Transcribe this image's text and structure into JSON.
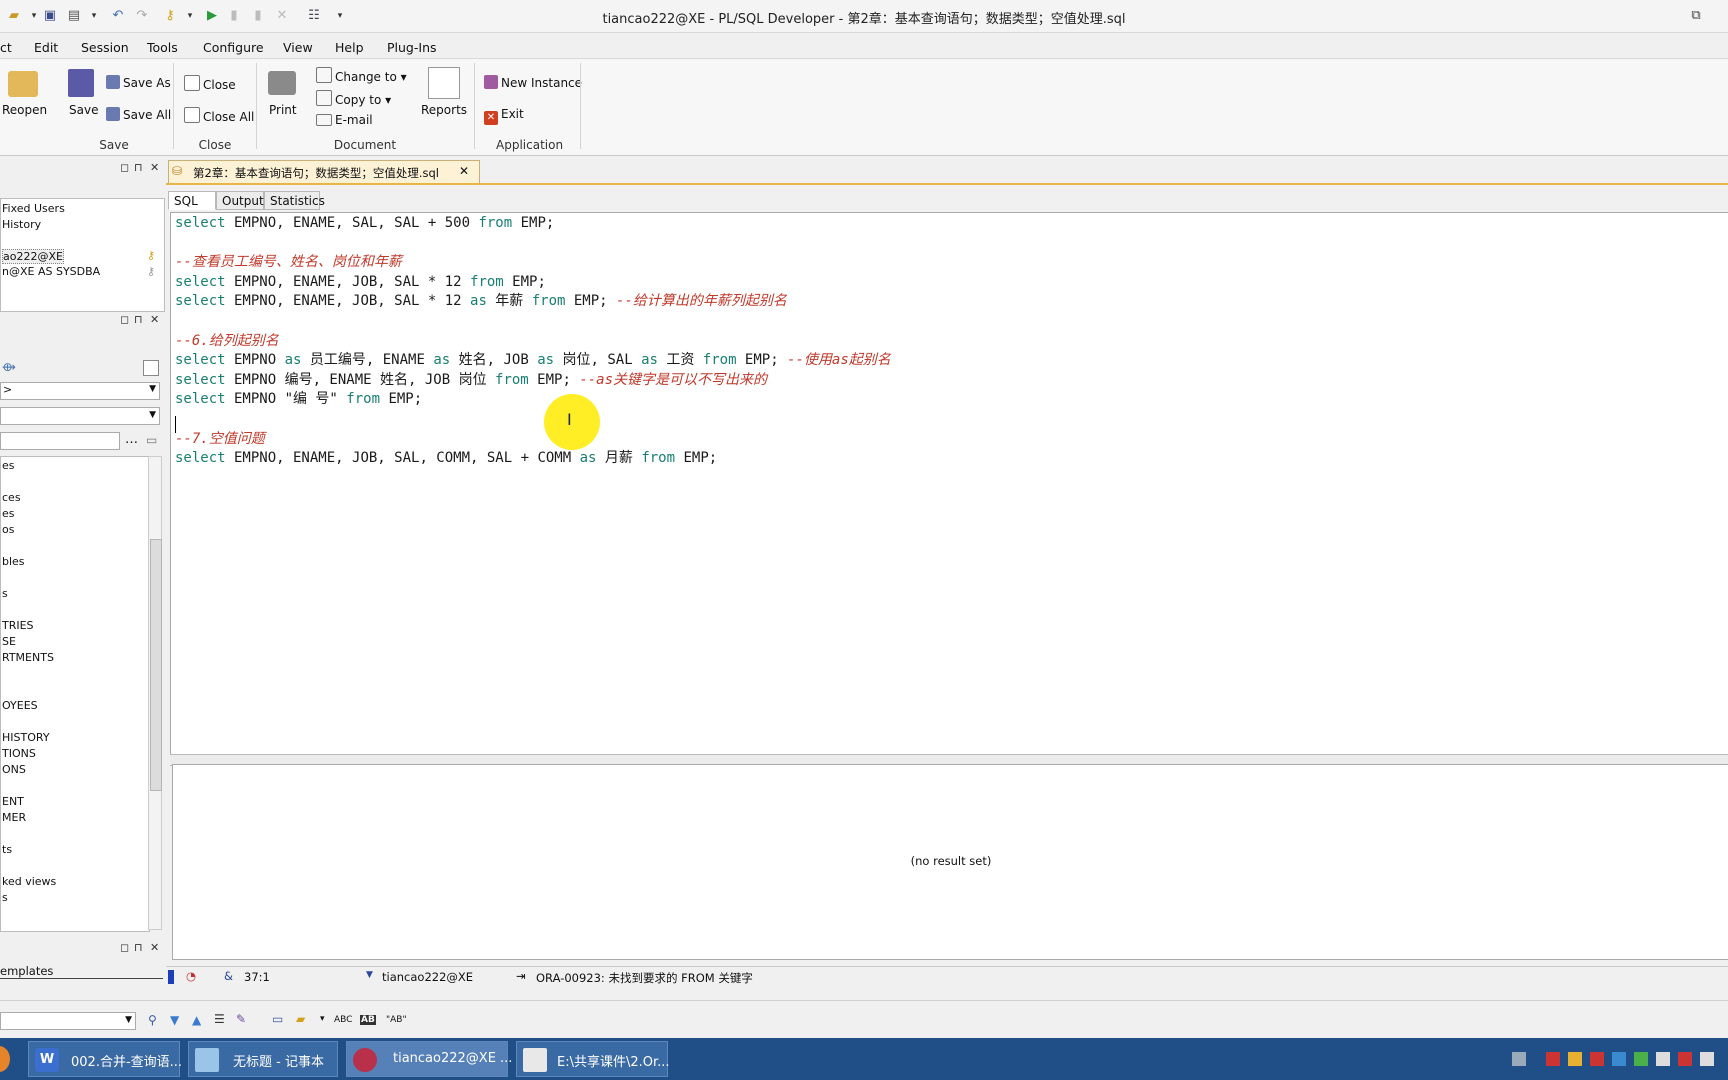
{
  "window": {
    "title": "tiancao222@XE - PL/SQL Developer - 第2章：基本查询语句；数据类型；空值处理.sql"
  },
  "menu": [
    "ct",
    "Edit",
    "Session",
    "Tools",
    "Configure",
    "View",
    "Help",
    "Plug-Ins"
  ],
  "ribbon": {
    "reopen": "Reopen",
    "save": "Save",
    "save_as": "Save As",
    "save_all": "Save All",
    "save_group": "Save",
    "close": "Close",
    "close_all": "Close All",
    "close_group": "Close",
    "print": "Print",
    "change_to": "Change to",
    "copy_to": "Copy to",
    "email": "E-mail",
    "document_group": "Document",
    "reports": "Reports",
    "new_instance": "New Instance",
    "exit": "Exit",
    "application_group": "Application"
  },
  "left": {
    "connections": [
      "Fixed Users",
      "History",
      "ao222@XE",
      "n@XE AS SYSDBA"
    ],
    "browser_items": [
      "es",
      "ces",
      "es",
      "os",
      "bles",
      "s",
      "TRIES",
      "SE",
      "RTMENTS",
      "OYEES",
      "HISTORY",
      "TIONS",
      "ONS",
      "ENT",
      "MER",
      "ts",
      "ked views",
      "s"
    ],
    "select_value": ">",
    "templates_label": "emplates"
  },
  "editor": {
    "doc_tab": "第2章：基本查询语句；数据类型；空值处理.sql",
    "tabs": [
      "SQL",
      "Output",
      "Statistics"
    ],
    "lines": [
      [
        [
          "k",
          "select"
        ],
        [
          "t",
          " EMPNO, ENAME, SAL, SAL + 500 "
        ],
        [
          "k",
          "from"
        ],
        [
          "t",
          " EMP;"
        ]
      ],
      [],
      [
        [
          "c",
          "--查看员工编号、姓名、岗位和年薪"
        ]
      ],
      [
        [
          "k",
          "select"
        ],
        [
          "t",
          " EMPNO, ENAME, JOB, SAL * 12 "
        ],
        [
          "k",
          "from"
        ],
        [
          "t",
          " EMP;"
        ]
      ],
      [
        [
          "k",
          "select"
        ],
        [
          "t",
          " EMPNO, ENAME, JOB, SAL * 12 "
        ],
        [
          "k",
          "as"
        ],
        [
          "t",
          " 年薪 "
        ],
        [
          "k",
          "from"
        ],
        [
          "t",
          " EMP; "
        ],
        [
          "c",
          "--给计算出的年薪列起别名"
        ]
      ],
      [],
      [
        [
          "c",
          "--6.给列起别名"
        ]
      ],
      [
        [
          "k",
          "select"
        ],
        [
          "t",
          " EMPNO "
        ],
        [
          "k",
          "as"
        ],
        [
          "t",
          " 员工编号, ENAME "
        ],
        [
          "k",
          "as"
        ],
        [
          "t",
          " 姓名, JOB "
        ],
        [
          "k",
          "as"
        ],
        [
          "t",
          " 岗位, SAL "
        ],
        [
          "k",
          "as"
        ],
        [
          "t",
          " 工资 "
        ],
        [
          "k",
          "from"
        ],
        [
          "t",
          " EMP; "
        ],
        [
          "c",
          "--使用as起别名"
        ]
      ],
      [
        [
          "k",
          "select"
        ],
        [
          "t",
          " EMPNO 编号, ENAME 姓名, JOB 岗位 "
        ],
        [
          "k",
          "from"
        ],
        [
          "t",
          " EMP; "
        ],
        [
          "c",
          "--as关键字是可以不写出来的"
        ]
      ],
      [
        [
          "k",
          "select"
        ],
        [
          "t",
          " EMPNO \"编 号\" "
        ],
        [
          "k",
          "from"
        ],
        [
          "t",
          " EMP;"
        ]
      ],
      [],
      [
        [
          "c",
          "--7.空值问题"
        ]
      ],
      [
        [
          "k",
          "select"
        ],
        [
          "t",
          " EMPNO, ENAME, JOB, SAL, COMM, SAL + COMM "
        ],
        [
          "k",
          "as"
        ],
        [
          "t",
          " 月薪 "
        ],
        [
          "k",
          "from"
        ],
        [
          "t",
          " EMP;"
        ]
      ]
    ],
    "no_result": "(no result set)"
  },
  "status": {
    "position": "37:1",
    "connection": "tiancao222@XE",
    "message": "ORA-00923: 未找到要求的 FROM 关键字"
  },
  "findbar": {
    "abc": "ABC",
    "ab_label": "AB",
    "quoted_ab": "\"AB\""
  },
  "taskbar": {
    "tasks": [
      "002.合并-查询语...",
      "无标题 - 记事本",
      "tiancao222@XE ...",
      "E:\\共享课件\\2.Or..."
    ]
  },
  "colors": {
    "keyword": "#1a7f73",
    "comment": "#c0392b",
    "taskbar": "#1f4f86"
  }
}
